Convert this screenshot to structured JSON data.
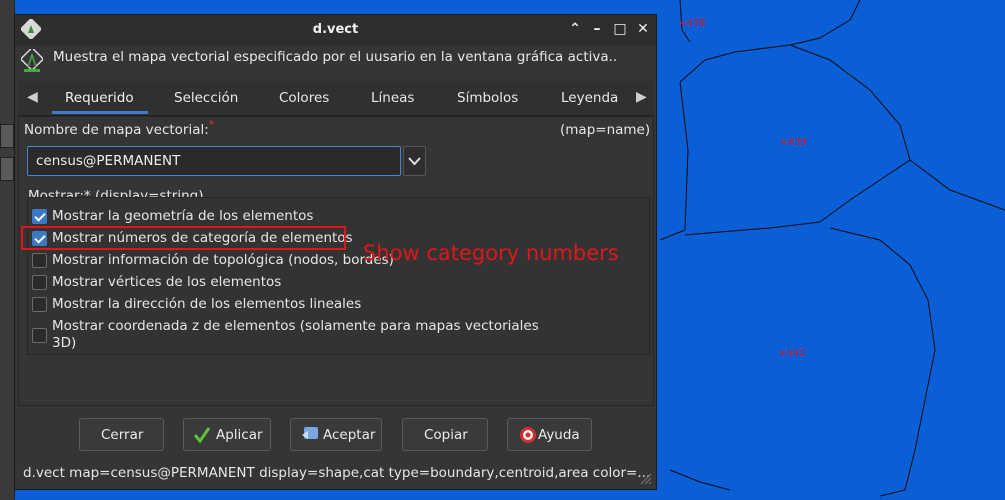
{
  "window": {
    "title": "d.vect",
    "description": "Muestra el mapa vectorial especificado por el uusario en la ventana gráfica activa..",
    "controls": {
      "minimize": "–",
      "maximize": "□",
      "close": "✕"
    }
  },
  "tabs": [
    "Requerido",
    "Selección",
    "Colores",
    "Líneas",
    "Símbolos",
    "Leyenda"
  ],
  "active_tab": "Requerido",
  "map_field": {
    "label": "Nombre de mapa vectorial:",
    "required_mark": "*",
    "param": "(map=name)",
    "value": "census@PERMANENT"
  },
  "display": {
    "label": "Mostrar:*  (display=string)",
    "options": [
      {
        "label": "Mostrar la geometría de los elementos",
        "checked": true
      },
      {
        "label": "Mostrar números de categoría de elementos",
        "checked": true
      },
      {
        "label": "Mostrar información de topológica (nodos, bordes)",
        "checked": false
      },
      {
        "label": "Mostrar vértices de los elementos",
        "checked": false
      },
      {
        "label": "Mostrar la dirección de los elementos lineales",
        "checked": false
      },
      {
        "label": "Mostrar coordenada z de elementos (solamente para mapas vectoriales",
        "label2": "3D)",
        "checked": false
      }
    ]
  },
  "buttons": {
    "close": "Cerrar",
    "apply": "Aplicar",
    "ok": "Aceptar",
    "copy": "Copiar",
    "help": "Ayuda"
  },
  "command": "d.vect map=census@PERMANENT display=shape,cat type=boundary,centroid,area color=...",
  "annotation": "Show category numbers",
  "map_labels": [
    "438",
    "439",
    "442"
  ],
  "colors": {
    "map_fill": "#0a5fd6",
    "accent": "#3d7cc9",
    "highlight": "#e0161b"
  }
}
